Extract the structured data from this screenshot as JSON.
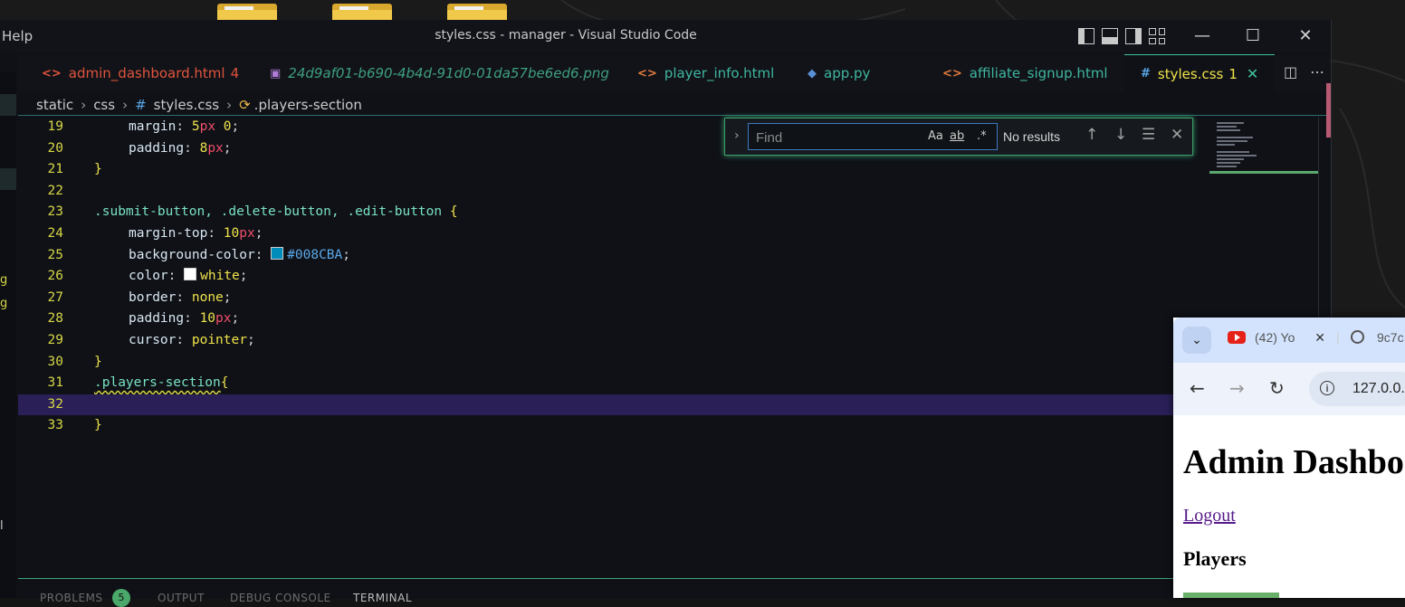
{
  "window": {
    "menu_help": "Help",
    "title": "styles.css - manager - Visual Studio Code",
    "minimize": "—",
    "maximize": "☐",
    "close": "✕"
  },
  "tabs": [
    {
      "label": "admin_dashboard.html",
      "badge": "4",
      "color": "#e0543e",
      "icon": "<>"
    },
    {
      "label": "24d9af01-b690-4b4d-91d0-01da57be6ed6.png",
      "color": "#3f9f7f",
      "icon": "img"
    },
    {
      "label": "player_info.html",
      "color": "#3fb6a0",
      "icon": "<>"
    },
    {
      "label": "app.py",
      "color": "#3fb6a0",
      "icon": "py"
    },
    {
      "label": "affiliate_signup.html",
      "color": "#3fb6a0",
      "icon": "<>"
    },
    {
      "label": "styles.css",
      "badge": "1",
      "color": "#f0e34a",
      "icon": "#",
      "active": true
    }
  ],
  "breadcrumb": {
    "items": [
      "static",
      "css",
      "styles.css",
      ".players-section"
    ]
  },
  "find": {
    "placeholder": "Find",
    "match_case": "Aa",
    "whole_word": "ab",
    "regex": ".*",
    "results": "No results"
  },
  "code_lines": [
    {
      "n": "19"
    },
    {
      "n": "20"
    },
    {
      "n": "21"
    },
    {
      "n": "22"
    },
    {
      "n": "23"
    },
    {
      "n": "24"
    },
    {
      "n": "25"
    },
    {
      "n": "26"
    },
    {
      "n": "27"
    },
    {
      "n": "28"
    },
    {
      "n": "29"
    },
    {
      "n": "30"
    },
    {
      "n": "31"
    },
    {
      "n": "32"
    },
    {
      "n": "33"
    }
  ],
  "code": {
    "l19_prop": "margin",
    "l19_val": "5",
    "l19_unit": "px",
    "l19_val2": "0",
    "l20_prop": "padding",
    "l20_val": "8",
    "l20_unit": "px",
    "l23_sel": ".submit-button, .delete-button, .edit-button",
    "l24_prop": "margin-top",
    "l24_val": "10",
    "l24_unit": "px",
    "l25_prop": "background-color",
    "l25_val": "#008CBA",
    "l26_prop": "color",
    "l26_val": "white",
    "l27_prop": "border",
    "l27_val": "none",
    "l28_prop": "padding",
    "l28_val": "10",
    "l28_unit": "px",
    "l29_prop": "cursor",
    "l29_val": "pointer",
    "l31_sel": ".players-section"
  },
  "panel": {
    "problems": "PROBLEMS",
    "problems_count": "5",
    "output": "OUTPUT",
    "debug": "DEBUG CONSOLE",
    "terminal": "TERMINAL"
  },
  "browser": {
    "tab1": "(42) Yo",
    "tab2": "9c7c",
    "url": "127.0.0.",
    "page_title": "Admin Dashboard",
    "logout": "Logout",
    "players_heading": "Players"
  },
  "colors": {
    "accent": "#3fc39a",
    "swatch_blue": "#008CBA",
    "swatch_white": "#ffffff"
  }
}
